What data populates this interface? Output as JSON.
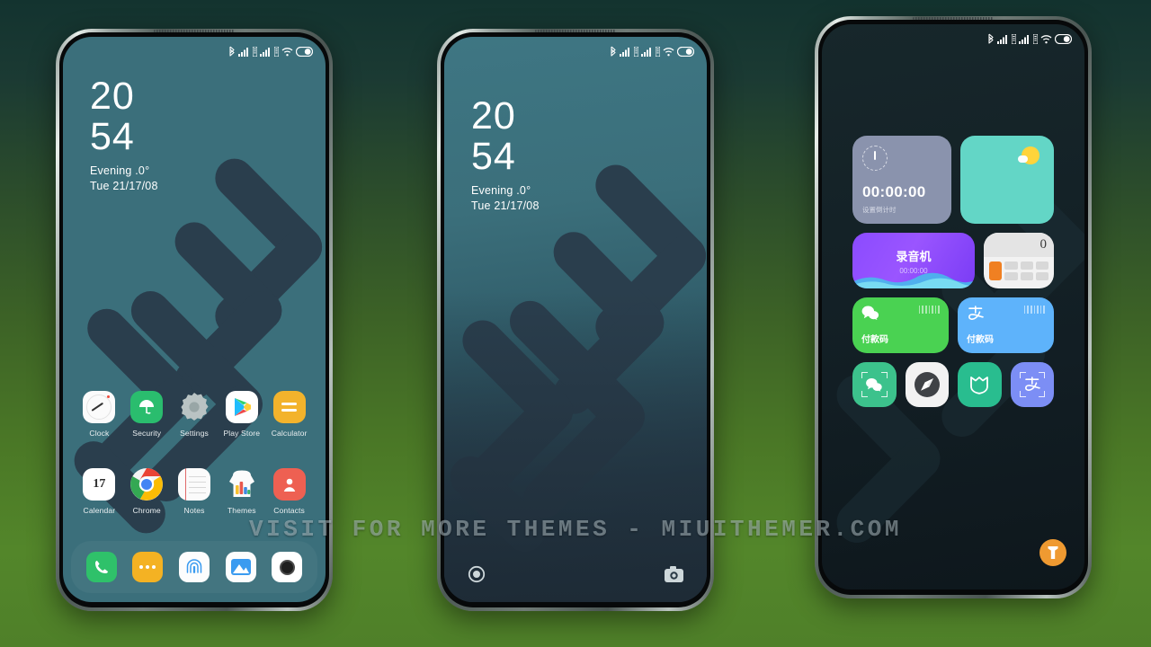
{
  "watermark": {
    "text": "VISIT FOR MORE THEMES - MIUITHEMER.COM"
  },
  "status_bar": {
    "icons": [
      "bluetooth-icon",
      "signal-1-icon",
      "sim-1-icon",
      "signal-2-icon",
      "sim-2-icon",
      "wifi-icon",
      "battery-icon"
    ]
  },
  "phone1": {
    "label": "home-screen",
    "clock": {
      "hours": "20",
      "minutes": "54",
      "weather": "Evening  .0°",
      "date": "Tue  21/17/08"
    },
    "apps_row1": [
      {
        "label": "Clock",
        "icon": "clock-app-icon"
      },
      {
        "label": "Security",
        "icon": "security-app-icon"
      },
      {
        "label": "Settings",
        "icon": "settings-app-icon"
      },
      {
        "label": "Play Store",
        "icon": "play-store-app-icon"
      },
      {
        "label": "Calculator",
        "icon": "calculator-app-icon"
      }
    ],
    "apps_row2": [
      {
        "label": "Calendar",
        "icon": "calendar-app-icon",
        "day": "17"
      },
      {
        "label": "Chrome",
        "icon": "chrome-app-icon"
      },
      {
        "label": "Notes",
        "icon": "notes-app-icon"
      },
      {
        "label": "Themes",
        "icon": "themes-app-icon"
      },
      {
        "label": "Contacts",
        "icon": "contacts-app-icon"
      }
    ],
    "dock": [
      {
        "label": "Phone",
        "icon": "phone-dock-icon"
      },
      {
        "label": "Messages",
        "icon": "messages-dock-icon"
      },
      {
        "label": "Scanner",
        "icon": "fingerprint-dock-icon"
      },
      {
        "label": "Gallery",
        "icon": "gallery-dock-icon"
      },
      {
        "label": "Camera",
        "icon": "camera-dock-icon"
      }
    ]
  },
  "phone2": {
    "label": "lock-screen",
    "clock": {
      "hours": "20",
      "minutes": "54",
      "weather": "Evening  .0°",
      "date": "Tue  21/17/08"
    },
    "lock_shortcuts": [
      {
        "label": "Flashlight",
        "icon": "torch-ring-icon"
      },
      {
        "label": "Camera",
        "icon": "camera-shortcut-icon"
      }
    ]
  },
  "phone3": {
    "label": "widgets-screen",
    "widgets": {
      "timer": {
        "title": "00:00:00",
        "subtitle": "设置倒计时",
        "icon": "stopwatch-icon",
        "color": "#8a93ad"
      },
      "weather": {
        "icon": "sun-cloud-icon",
        "color": "#63d6c6"
      },
      "recorder": {
        "title": "录音机",
        "subtitle": "00:00:00",
        "color": "#8b4bff"
      },
      "calculator": {
        "display": "0",
        "color": "#f2f2f2",
        "accent": "#f08022"
      },
      "wechat_pay": {
        "title": "付款码",
        "icon": "wechat-icon",
        "color": "#4ad252"
      },
      "alipay_pay": {
        "title": "付款码",
        "icon": "alipay-icon",
        "color": "#5eb3fb"
      }
    },
    "shortcuts": [
      {
        "icon": "wechat-scan-icon",
        "color": "#3cc28c"
      },
      {
        "icon": "safari-compass-icon",
        "color": "#f2f2f2"
      },
      {
        "icon": "mi-home-icon",
        "color": "#29bd8f"
      },
      {
        "icon": "alipay-scan-icon",
        "color": "#7c8ef5"
      }
    ],
    "torch_button": {
      "icon": "flashlight-icon",
      "color": "#ef9a31"
    }
  },
  "theme": {
    "background_gradient_top": "#13332f",
    "background_gradient_bottom": "#4f8029",
    "wallpaper_teal": "#3b6f7b",
    "wallpaper_stripe": "#2a3e4d"
  }
}
